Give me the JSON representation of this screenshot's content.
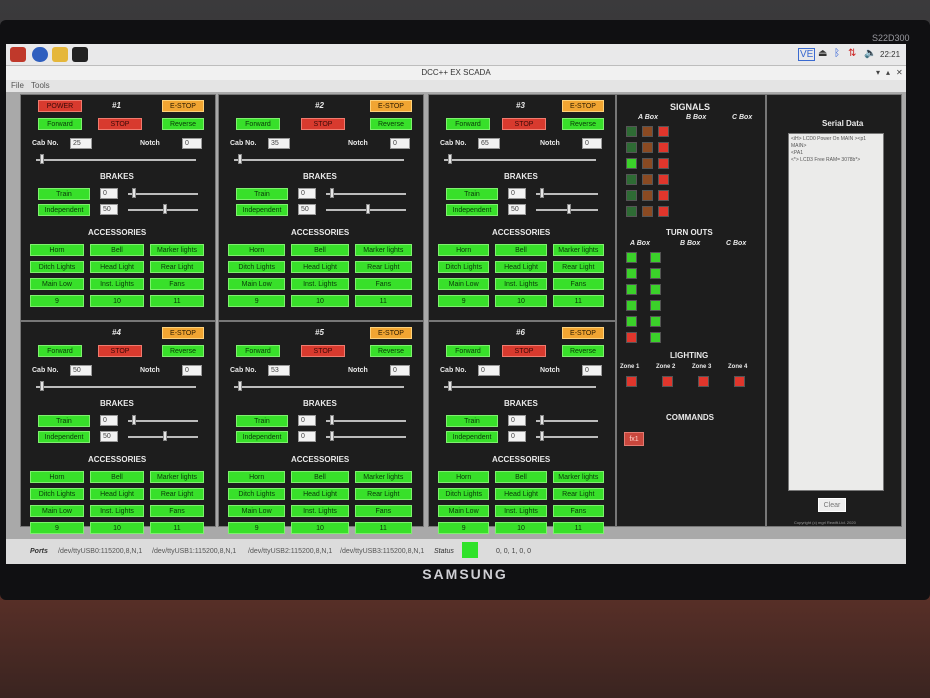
{
  "monitor": {
    "brand": "SAMSUNG",
    "model": "S22D300"
  },
  "taskbar": {
    "clock": "22:21",
    "tray_label": "VE"
  },
  "window": {
    "title": "DCC++ EX  SCADA"
  },
  "menu": {
    "file": "File",
    "tools": "Tools"
  },
  "throttles": [
    {
      "number": "#1",
      "power": "POWER",
      "estop": "E-STOP",
      "forward": "Forward",
      "stop": "STOP",
      "reverse": "Reverse",
      "cab_label": "Cab No.",
      "cab": "25",
      "notch_label": "Notch",
      "notch": "0",
      "brakes": "BRAKES",
      "train": "Train",
      "train_val": "0",
      "independent": "Independent",
      "independent_val": "50",
      "accessories": "ACCESSORIES",
      "acc": [
        "Horn",
        "Bell",
        "Marker lights",
        "Ditch Lights",
        "Head Light",
        "Rear Light",
        "Main Low",
        "Inst. Lights",
        "Fans",
        "9",
        "10",
        "11"
      ]
    },
    {
      "number": "#2",
      "estop": "E-STOP",
      "forward": "Forward",
      "stop": "STOP",
      "reverse": "Reverse",
      "cab_label": "Cab No.",
      "cab": "35",
      "notch_label": "Notch",
      "notch": "0",
      "brakes": "BRAKES",
      "train": "Train",
      "train_val": "0",
      "independent": "Independent",
      "independent_val": "50",
      "accessories": "ACCESSORIES",
      "acc": [
        "Horn",
        "Bell",
        "Marker lights",
        "Ditch Lights",
        "Head Light",
        "Rear Light",
        "Main Low",
        "Inst. Lights",
        "Fans",
        "9",
        "10",
        "11"
      ]
    },
    {
      "number": "#3",
      "estop": "E-STOP",
      "forward": "Forward",
      "stop": "STOP",
      "reverse": "Reverse",
      "cab_label": "Cab No.",
      "cab": "65",
      "notch_label": "Notch",
      "notch": "0",
      "brakes": "BRAKES",
      "train": "Train",
      "train_val": "0",
      "independent": "Independent",
      "independent_val": "50",
      "accessories": "ACCESSORIES",
      "acc": [
        "Horn",
        "Bell",
        "Marker lights",
        "Ditch Lights",
        "Head Light",
        "Rear Light",
        "Main Low",
        "Inst. Lights",
        "Fans",
        "9",
        "10",
        "11"
      ]
    },
    {
      "number": "#4",
      "estop": "E-STOP",
      "forward": "Forward",
      "stop": "STOP",
      "reverse": "Reverse",
      "cab_label": "Cab No.",
      "cab": "50",
      "notch_label": "Notch",
      "notch": "0",
      "brakes": "BRAKES",
      "train": "Train",
      "train_val": "0",
      "independent": "Independent",
      "independent_val": "50",
      "accessories": "ACCESSORIES",
      "acc": [
        "Horn",
        "Bell",
        "Marker lights",
        "Ditch Lights",
        "Head Light",
        "Rear Light",
        "Main Low",
        "Inst. Lights",
        "Fans",
        "9",
        "10",
        "11"
      ]
    },
    {
      "number": "#5",
      "estop": "E-STOP",
      "forward": "Forward",
      "stop": "STOP",
      "reverse": "Reverse",
      "cab_label": "Cab No.",
      "cab": "53",
      "notch_label": "Notch",
      "notch": "0",
      "brakes": "BRAKES",
      "train": "Train",
      "train_val": "0",
      "independent": "Independent",
      "independent_val": "0",
      "accessories": "ACCESSORIES",
      "acc": [
        "Horn",
        "Bell",
        "Marker lights",
        "Ditch Lights",
        "Head Light",
        "Rear Light",
        "Main Low",
        "Inst. Lights",
        "Fans",
        "9",
        "10",
        "11"
      ]
    },
    {
      "number": "#6",
      "estop": "E-STOP",
      "forward": "Forward",
      "stop": "STOP",
      "reverse": "Reverse",
      "cab_label": "Cab No.",
      "cab": "0",
      "notch_label": "Notch",
      "notch": "0",
      "brakes": "BRAKES",
      "train": "Train",
      "train_val": "0",
      "independent": "Independent",
      "independent_val": "0",
      "accessories": "ACCESSORIES",
      "acc": [
        "Horn",
        "Bell",
        "Marker lights",
        "Ditch Lights",
        "Head Light",
        "Rear Light",
        "Main Low",
        "Inst. Lights",
        "Fans",
        "9",
        "10",
        "11"
      ]
    }
  ],
  "signals": {
    "title": "SIGNALS",
    "a_box": "A Box",
    "b_box": "B Box",
    "c_box": "C Box",
    "colors": {
      "green": "#2e6b34",
      "green_lit": "#3bd12a",
      "amber": "#8a4a22",
      "red": "#e0362c"
    }
  },
  "turnouts": {
    "title": "TURN OUTS",
    "a_box": "A Box",
    "b_box": "B Box",
    "c_box": "C Box"
  },
  "lighting": {
    "title": "LIGHTING",
    "zones": [
      "Zone 1",
      "Zone 2",
      "Zone 3",
      "Zone 4"
    ]
  },
  "commands": {
    "title": "COMMANDS",
    "button": "fx1"
  },
  "serial": {
    "title": "Serial Data",
    "log": "<iH> LCD0 Power On MAIN ><p1 MAIN>\n<PA1\n<*> LCD3 Free RAM= 3078b*>",
    "clear": "Clear",
    "copyright": "Copyright (c) mgrl Rewift.Ltd. 2020"
  },
  "statusbar": {
    "ports_label": "Ports",
    "ports": [
      "/dev/ttyUSB0:115200,8,N,1",
      "/dev/ttyUSB1:115200,8,N,1",
      "/dev/ttyUSB2:115200,8,N,1",
      "/dev/ttyUSB3:115200,8,N,1"
    ],
    "status_label": "Status",
    "status_value": "0, 0, 1, 0, 0"
  }
}
